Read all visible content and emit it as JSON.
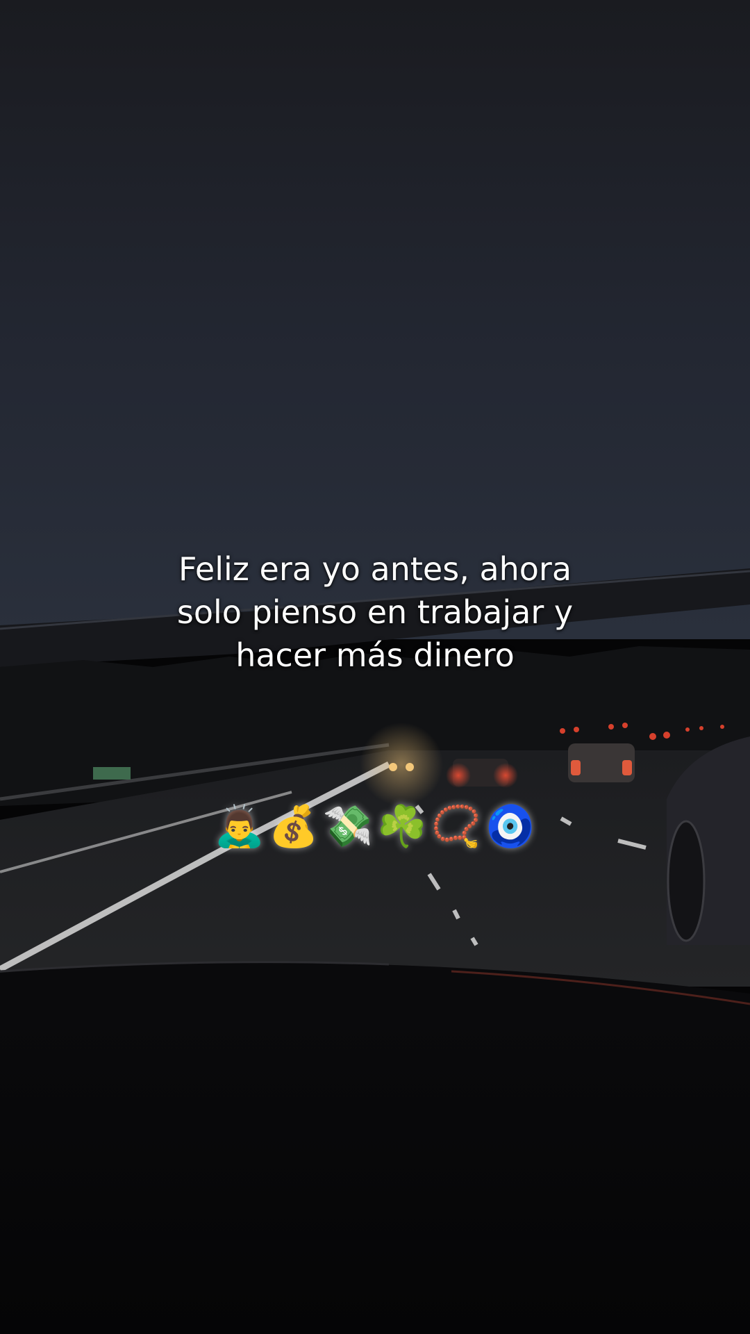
{
  "caption": {
    "lines": [
      "Feliz era yo antes, ahora",
      "solo pienso en trabajar y",
      "hacer más dinero"
    ]
  },
  "emojis": [
    {
      "icon": "bowing-person-icon",
      "glyph": "🙇‍♂️"
    },
    {
      "icon": "money-bag-icon",
      "glyph": "💰"
    },
    {
      "icon": "money-with-wings-icon",
      "glyph": "💸"
    },
    {
      "icon": "shamrock-icon",
      "glyph": "☘️"
    },
    {
      "icon": "prayer-beads-icon",
      "glyph": "📿"
    },
    {
      "icon": "nazar-amulet-icon",
      "glyph": "🧿"
    }
  ],
  "colors": {
    "sky_top": "#1a1b20",
    "sky_bottom": "#262b37",
    "road": "#1a1a1a",
    "lane_marking": "#d9d9d9",
    "tail_light": "#d6402c",
    "head_light": "#f3c77a",
    "dashboard": "#050506",
    "caption_text": "#ffffff"
  }
}
